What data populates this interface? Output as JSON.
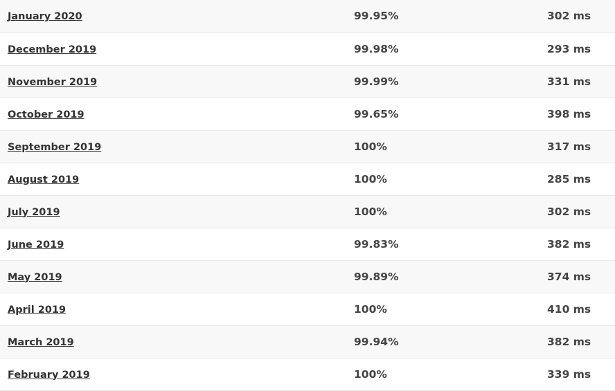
{
  "rows": [
    {
      "month": "January 2020",
      "uptime": "99.95%",
      "response": "302 ms"
    },
    {
      "month": "December 2019",
      "uptime": "99.98%",
      "response": "293 ms"
    },
    {
      "month": "November 2019",
      "uptime": "99.99%",
      "response": "331 ms"
    },
    {
      "month": "October 2019",
      "uptime": "99.65%",
      "response": "398 ms"
    },
    {
      "month": "September 2019",
      "uptime": "100%",
      "response": "317 ms"
    },
    {
      "month": "August 2019",
      "uptime": "100%",
      "response": "285 ms"
    },
    {
      "month": "July 2019",
      "uptime": "100%",
      "response": "302 ms"
    },
    {
      "month": "June 2019",
      "uptime": "99.83%",
      "response": "382 ms"
    },
    {
      "month": "May 2019",
      "uptime": "99.89%",
      "response": "374 ms"
    },
    {
      "month": "April 2019",
      "uptime": "100%",
      "response": "410 ms"
    },
    {
      "month": "March 2019",
      "uptime": "99.94%",
      "response": "382 ms"
    },
    {
      "month": "February 2019",
      "uptime": "100%",
      "response": "339 ms"
    }
  ]
}
